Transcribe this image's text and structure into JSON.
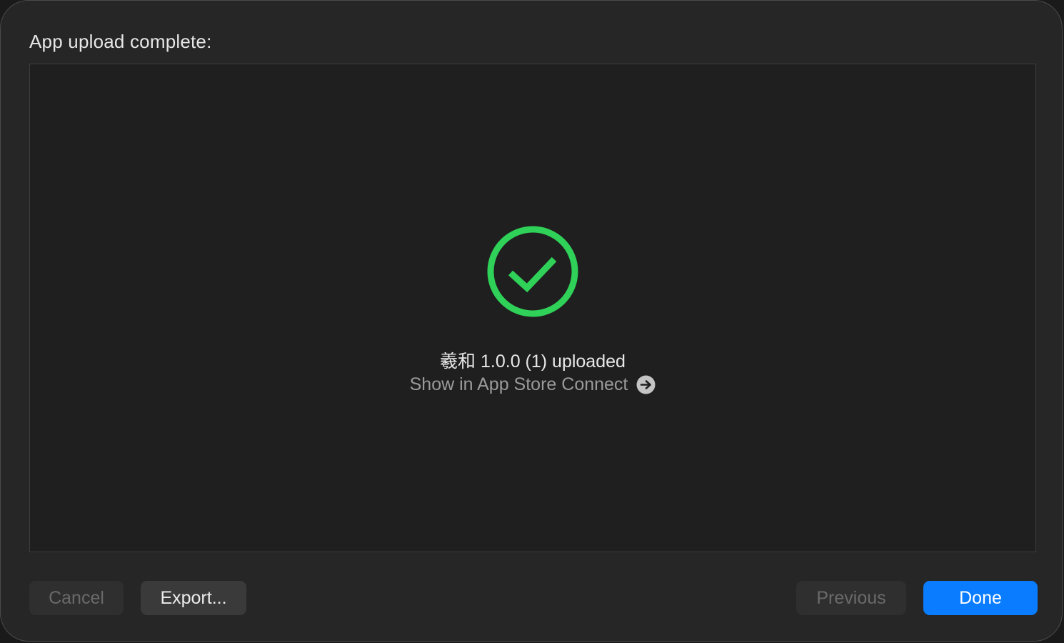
{
  "dialog": {
    "title": "App upload complete:"
  },
  "result": {
    "status_icon": "checkmark-circle-icon",
    "status_color": "#2fd158",
    "status_text": "羲和 1.0.0 (1) uploaded",
    "link_label": "Show in App Store Connect",
    "link_icon": "arrow-right-circle-icon"
  },
  "footer": {
    "cancel_label": "Cancel",
    "export_label": "Export...",
    "previous_label": "Previous",
    "done_label": "Done",
    "accent_color": "#0a7cff"
  }
}
